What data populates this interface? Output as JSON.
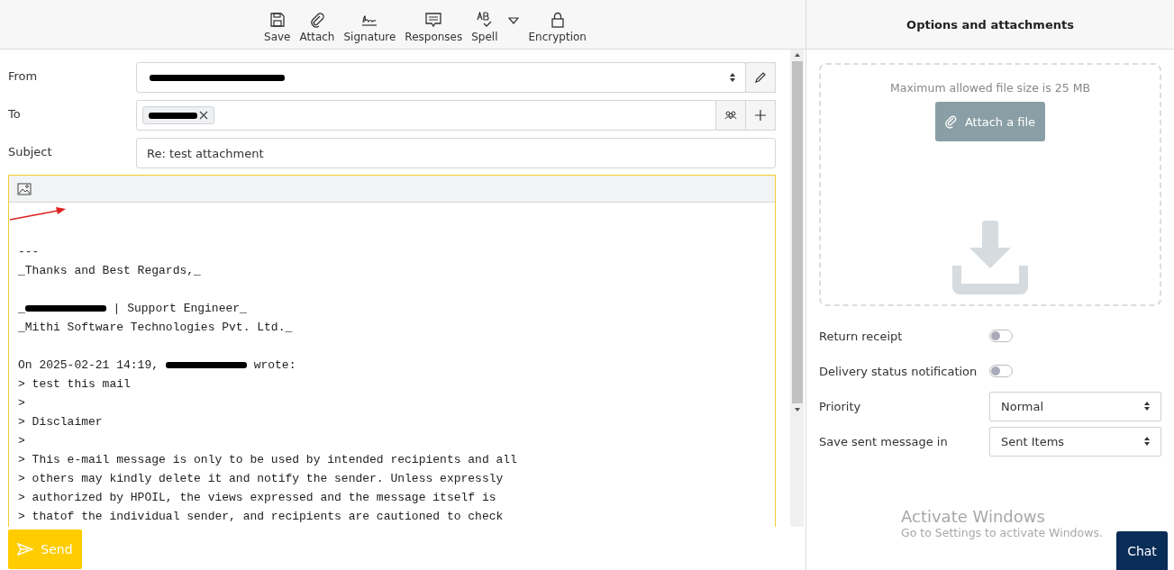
{
  "toolbar": [
    {
      "kind": "save",
      "label": "Save"
    },
    {
      "kind": "attach",
      "label": "Attach"
    },
    {
      "kind": "signature",
      "label": "Signature"
    },
    {
      "kind": "responses",
      "label": "Responses"
    },
    {
      "kind": "spell",
      "label": "Spell"
    },
    {
      "kind": "caret"
    },
    {
      "kind": "encryption",
      "label": "Encryption"
    }
  ],
  "from": {
    "label": "From",
    "redacted": true
  },
  "to": {
    "label": "To",
    "recipients": [
      {
        "redacted": true
      }
    ]
  },
  "subject": {
    "label": "Subject",
    "value": "Re: test attachment"
  },
  "body": [
    {
      "kind": "blank"
    },
    {
      "kind": "blank"
    },
    {
      "kind": "line",
      "parts": [
        {
          "kind": "text",
          "text": "---"
        }
      ]
    },
    {
      "kind": "line",
      "parts": [
        {
          "kind": "text",
          "text": "_Thanks and Best Regards,_"
        }
      ]
    },
    {
      "kind": "blank"
    },
    {
      "kind": "line",
      "parts": [
        {
          "kind": "text",
          "text": "_"
        },
        {
          "kind": "redacted"
        },
        {
          "kind": "text",
          "text": " | Support Engineer_"
        }
      ]
    },
    {
      "kind": "line",
      "parts": [
        {
          "kind": "text",
          "text": "_Mithi Software Technologies Pvt. Ltd._"
        }
      ]
    },
    {
      "kind": "blank"
    },
    {
      "kind": "line",
      "parts": [
        {
          "kind": "text",
          "text": "On 2025-02-21 14:19, "
        },
        {
          "kind": "redacted"
        },
        {
          "kind": "text",
          "text": " wrote:"
        }
      ]
    },
    {
      "kind": "line",
      "parts": [
        {
          "kind": "text",
          "text": "> test this mail"
        }
      ]
    },
    {
      "kind": "line",
      "parts": [
        {
          "kind": "text",
          "text": ">"
        }
      ]
    },
    {
      "kind": "line",
      "parts": [
        {
          "kind": "text",
          "text": "> Disclaimer"
        }
      ]
    },
    {
      "kind": "line",
      "parts": [
        {
          "kind": "text",
          "text": ">"
        }
      ]
    },
    {
      "kind": "line",
      "parts": [
        {
          "kind": "text",
          "text": "> This e-mail message is only to be used by intended recipients and all"
        }
      ]
    },
    {
      "kind": "line",
      "parts": [
        {
          "kind": "text",
          "text": "> others may kindly delete it and notify the sender. Unless expressly"
        }
      ]
    },
    {
      "kind": "line",
      "parts": [
        {
          "kind": "text",
          "text": "> authorized by HPOIL, the views expressed and the message itself is"
        }
      ]
    },
    {
      "kind": "line",
      "parts": [
        {
          "kind": "text",
          "text": "> thatof the individual sender, and recipients are cautioned to check"
        }
      ]
    }
  ],
  "send": "Send",
  "panel": {
    "title": "Options and attachments",
    "max_size": "Maximum allowed file size is 25 MB",
    "attach_button": "Attach a file",
    "options": [
      {
        "kind": "toggle",
        "label": "Return receipt",
        "on": false
      },
      {
        "kind": "toggle",
        "label": "Delivery status notification",
        "on": false
      },
      {
        "kind": "select",
        "label": "Priority",
        "value": "Normal"
      },
      {
        "kind": "select",
        "label": "Save sent message in",
        "value": "Sent Items"
      }
    ]
  },
  "activation": {
    "title": "Activate Windows",
    "text": "Go to Settings to activate Windows."
  },
  "chat": "Chat"
}
